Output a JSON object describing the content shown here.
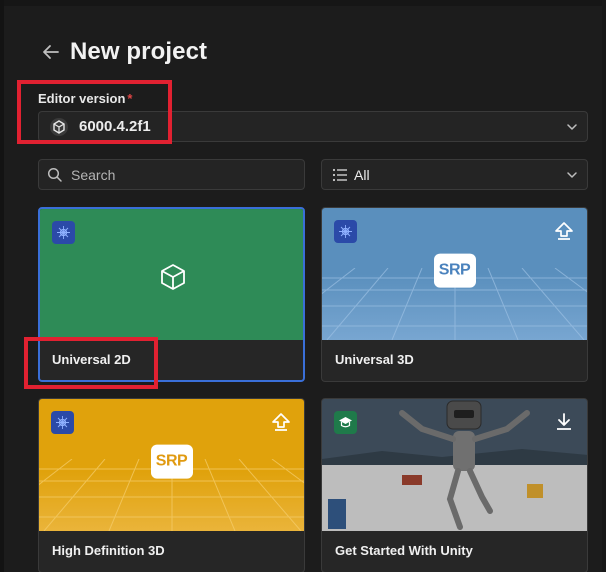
{
  "header": {
    "title": "New project"
  },
  "editor_version": {
    "label": "Editor version",
    "required_mark": "*",
    "value": "6000.4.2f1"
  },
  "search": {
    "placeholder": "Search",
    "value": ""
  },
  "filter": {
    "value": "All"
  },
  "templates": [
    {
      "name": "Universal 2D",
      "badge": "render-pipeline-icon",
      "selected": true,
      "thumb_color": "#2e8b57"
    },
    {
      "name": "Universal 3D",
      "badge": "render-pipeline-icon",
      "action_icon": "upgrade-icon",
      "tile": "SRP",
      "thumb_color": "#5a8fbd"
    },
    {
      "name": "High Definition 3D",
      "badge": "render-pipeline-icon",
      "action_icon": "upgrade-icon",
      "tile": "SRP",
      "thumb_color": "#e0a20c"
    },
    {
      "name": "Get Started With Unity",
      "badge": "graduation-cap-icon",
      "action_icon": "download-icon",
      "thumb_color": "#3d4a5a"
    }
  ],
  "colors": {
    "background": "#1c1c1c",
    "selection": "#3a6fd8",
    "required": "#e04545",
    "annotation": "#e12131"
  }
}
